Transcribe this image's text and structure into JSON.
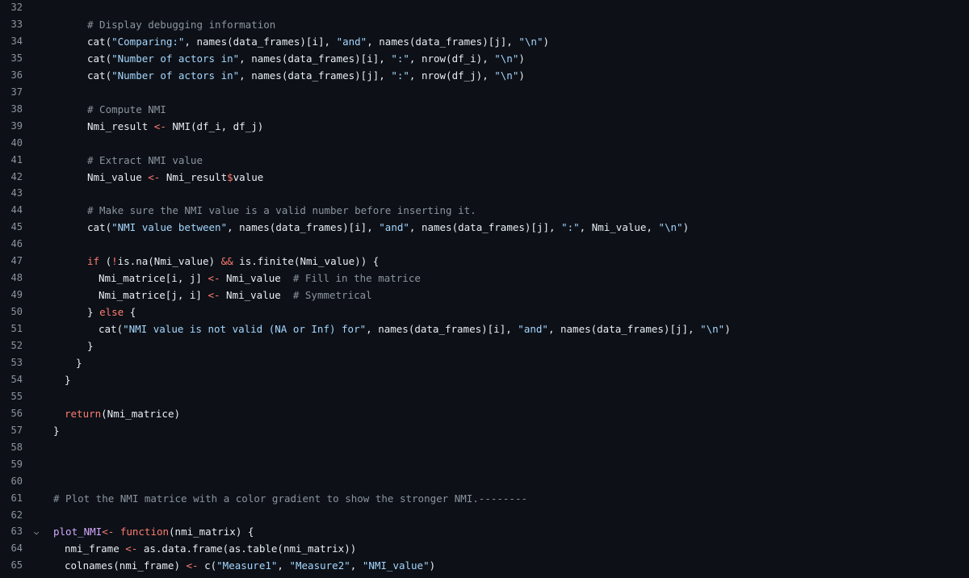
{
  "editor": {
    "lines": [
      {
        "num": "32",
        "indent": 0,
        "fold": "",
        "tokens": []
      },
      {
        "num": "33",
        "indent": 3,
        "fold": "",
        "tokens": [
          {
            "t": "c",
            "v": "# Display debugging information"
          }
        ]
      },
      {
        "num": "34",
        "indent": 3,
        "fold": "",
        "tokens": [
          {
            "t": "f",
            "v": "cat("
          },
          {
            "t": "s",
            "v": "\"Comparing:\""
          },
          {
            "t": "n",
            "v": ", names(data_frames)[i], "
          },
          {
            "t": "s",
            "v": "\"and\""
          },
          {
            "t": "n",
            "v": ", names(data_frames)[j], "
          },
          {
            "t": "s",
            "v": "\"\\n\""
          },
          {
            "t": "n",
            "v": ")"
          }
        ]
      },
      {
        "num": "35",
        "indent": 3,
        "fold": "",
        "tokens": [
          {
            "t": "f",
            "v": "cat("
          },
          {
            "t": "s",
            "v": "\"Number of actors in\""
          },
          {
            "t": "n",
            "v": ", names(data_frames)[i], "
          },
          {
            "t": "s",
            "v": "\":\""
          },
          {
            "t": "n",
            "v": ", nrow(df_i), "
          },
          {
            "t": "s",
            "v": "\"\\n\""
          },
          {
            "t": "n",
            "v": ")"
          }
        ]
      },
      {
        "num": "36",
        "indent": 3,
        "fold": "",
        "tokens": [
          {
            "t": "f",
            "v": "cat("
          },
          {
            "t": "s",
            "v": "\"Number of actors in\""
          },
          {
            "t": "n",
            "v": ", names(data_frames)[j], "
          },
          {
            "t": "s",
            "v": "\":\""
          },
          {
            "t": "n",
            "v": ", nrow(df_j), "
          },
          {
            "t": "s",
            "v": "\"\\n\""
          },
          {
            "t": "n",
            "v": ")"
          }
        ]
      },
      {
        "num": "37",
        "indent": 0,
        "fold": "",
        "tokens": []
      },
      {
        "num": "38",
        "indent": 3,
        "fold": "",
        "tokens": [
          {
            "t": "c",
            "v": "# Compute NMI"
          }
        ]
      },
      {
        "num": "39",
        "indent": 3,
        "fold": "",
        "tokens": [
          {
            "t": "n",
            "v": "Nmi_result "
          },
          {
            "t": "o",
            "v": "<-"
          },
          {
            "t": "n",
            "v": " NMI(df_i, df_j)"
          }
        ]
      },
      {
        "num": "40",
        "indent": 0,
        "fold": "",
        "tokens": []
      },
      {
        "num": "41",
        "indent": 3,
        "fold": "",
        "tokens": [
          {
            "t": "c",
            "v": "# Extract NMI value"
          }
        ]
      },
      {
        "num": "42",
        "indent": 3,
        "fold": "",
        "tokens": [
          {
            "t": "n",
            "v": "Nmi_value "
          },
          {
            "t": "o",
            "v": "<-"
          },
          {
            "t": "n",
            "v": " Nmi_result"
          },
          {
            "t": "o",
            "v": "$"
          },
          {
            "t": "n",
            "v": "value"
          }
        ]
      },
      {
        "num": "43",
        "indent": 0,
        "fold": "",
        "tokens": []
      },
      {
        "num": "44",
        "indent": 3,
        "fold": "",
        "tokens": [
          {
            "t": "c",
            "v": "# Make sure the NMI value is a valid number before inserting it."
          }
        ]
      },
      {
        "num": "45",
        "indent": 3,
        "fold": "",
        "tokens": [
          {
            "t": "f",
            "v": "cat("
          },
          {
            "t": "s",
            "v": "\"NMI value between\""
          },
          {
            "t": "n",
            "v": ", names(data_frames)[i], "
          },
          {
            "t": "s",
            "v": "\"and\""
          },
          {
            "t": "n",
            "v": ", names(data_frames)[j], "
          },
          {
            "t": "s",
            "v": "\":\""
          },
          {
            "t": "n",
            "v": ", Nmi_value, "
          },
          {
            "t": "s",
            "v": "\"\\n\""
          },
          {
            "t": "n",
            "v": ")"
          }
        ]
      },
      {
        "num": "46",
        "indent": 0,
        "fold": "",
        "tokens": []
      },
      {
        "num": "47",
        "indent": 3,
        "fold": "",
        "tokens": [
          {
            "t": "k",
            "v": "if"
          },
          {
            "t": "n",
            "v": " ("
          },
          {
            "t": "o",
            "v": "!"
          },
          {
            "t": "n",
            "v": "is.na(Nmi_value) "
          },
          {
            "t": "o",
            "v": "&&"
          },
          {
            "t": "n",
            "v": " is.finite(Nmi_value)) {"
          }
        ]
      },
      {
        "num": "48",
        "indent": 4,
        "fold": "",
        "tokens": [
          {
            "t": "n",
            "v": "Nmi_matrice[i, j] "
          },
          {
            "t": "o",
            "v": "<-"
          },
          {
            "t": "n",
            "v": " Nmi_value  "
          },
          {
            "t": "c",
            "v": "# Fill in the matrice"
          }
        ]
      },
      {
        "num": "49",
        "indent": 4,
        "fold": "",
        "tokens": [
          {
            "t": "n",
            "v": "Nmi_matrice[j, i] "
          },
          {
            "t": "o",
            "v": "<-"
          },
          {
            "t": "n",
            "v": " Nmi_value  "
          },
          {
            "t": "c",
            "v": "# Symmetrical"
          }
        ]
      },
      {
        "num": "50",
        "indent": 3,
        "fold": "",
        "tokens": [
          {
            "t": "n",
            "v": "} "
          },
          {
            "t": "k",
            "v": "else"
          },
          {
            "t": "n",
            "v": " {"
          }
        ]
      },
      {
        "num": "51",
        "indent": 4,
        "fold": "",
        "tokens": [
          {
            "t": "f",
            "v": "cat("
          },
          {
            "t": "s",
            "v": "\"NMI value is not valid (NA or Inf) for\""
          },
          {
            "t": "n",
            "v": ", names(data_frames)[i], "
          },
          {
            "t": "s",
            "v": "\"and\""
          },
          {
            "t": "n",
            "v": ", names(data_frames)[j], "
          },
          {
            "t": "s",
            "v": "\"\\n\""
          },
          {
            "t": "n",
            "v": ")"
          }
        ]
      },
      {
        "num": "52",
        "indent": 3,
        "fold": "",
        "tokens": [
          {
            "t": "n",
            "v": "}"
          }
        ]
      },
      {
        "num": "53",
        "indent": 2,
        "fold": "",
        "tokens": [
          {
            "t": "n",
            "v": "}"
          }
        ]
      },
      {
        "num": "54",
        "indent": 1,
        "fold": "",
        "tokens": [
          {
            "t": "n",
            "v": "}"
          }
        ]
      },
      {
        "num": "55",
        "indent": 0,
        "fold": "",
        "tokens": []
      },
      {
        "num": "56",
        "indent": 1,
        "fold": "",
        "tokens": [
          {
            "t": "k",
            "v": "return"
          },
          {
            "t": "n",
            "v": "(Nmi_matrice)"
          }
        ]
      },
      {
        "num": "57",
        "indent": 0,
        "fold": "",
        "tokens": [
          {
            "t": "n",
            "v": "}"
          }
        ]
      },
      {
        "num": "58",
        "indent": 0,
        "fold": "",
        "tokens": []
      },
      {
        "num": "59",
        "indent": 0,
        "fold": "",
        "tokens": []
      },
      {
        "num": "60",
        "indent": 0,
        "fold": "",
        "tokens": []
      },
      {
        "num": "61",
        "indent": 0,
        "fold": "",
        "tokens": [
          {
            "t": "c",
            "v": "# Plot the NMI matrice with a color gradient to show the stronger NMI.--------"
          }
        ]
      },
      {
        "num": "62",
        "indent": 0,
        "fold": "",
        "tokens": []
      },
      {
        "num": "63",
        "indent": 0,
        "fold": "⌵",
        "tokens": [
          {
            "t": "p",
            "v": "plot_NMI"
          },
          {
            "t": "o",
            "v": "<-"
          },
          {
            "t": "n",
            "v": " "
          },
          {
            "t": "k",
            "v": "function"
          },
          {
            "t": "n",
            "v": "(nmi_matrix) {"
          }
        ]
      },
      {
        "num": "64",
        "indent": 1,
        "fold": "",
        "tokens": [
          {
            "t": "n",
            "v": "nmi_frame "
          },
          {
            "t": "o",
            "v": "<-"
          },
          {
            "t": "n",
            "v": " as.data.frame(as.table(nmi_matrix))"
          }
        ]
      },
      {
        "num": "65",
        "indent": 1,
        "fold": "",
        "tokens": [
          {
            "t": "n",
            "v": "colnames(nmi_frame) "
          },
          {
            "t": "o",
            "v": "<-"
          },
          {
            "t": "n",
            "v": " c("
          },
          {
            "t": "s",
            "v": "\"Measure1\""
          },
          {
            "t": "n",
            "v": ", "
          },
          {
            "t": "s",
            "v": "\"Measure2\""
          },
          {
            "t": "n",
            "v": ", "
          },
          {
            "t": "s",
            "v": "\"NMI_value\""
          },
          {
            "t": "n",
            "v": ")"
          }
        ]
      }
    ]
  }
}
